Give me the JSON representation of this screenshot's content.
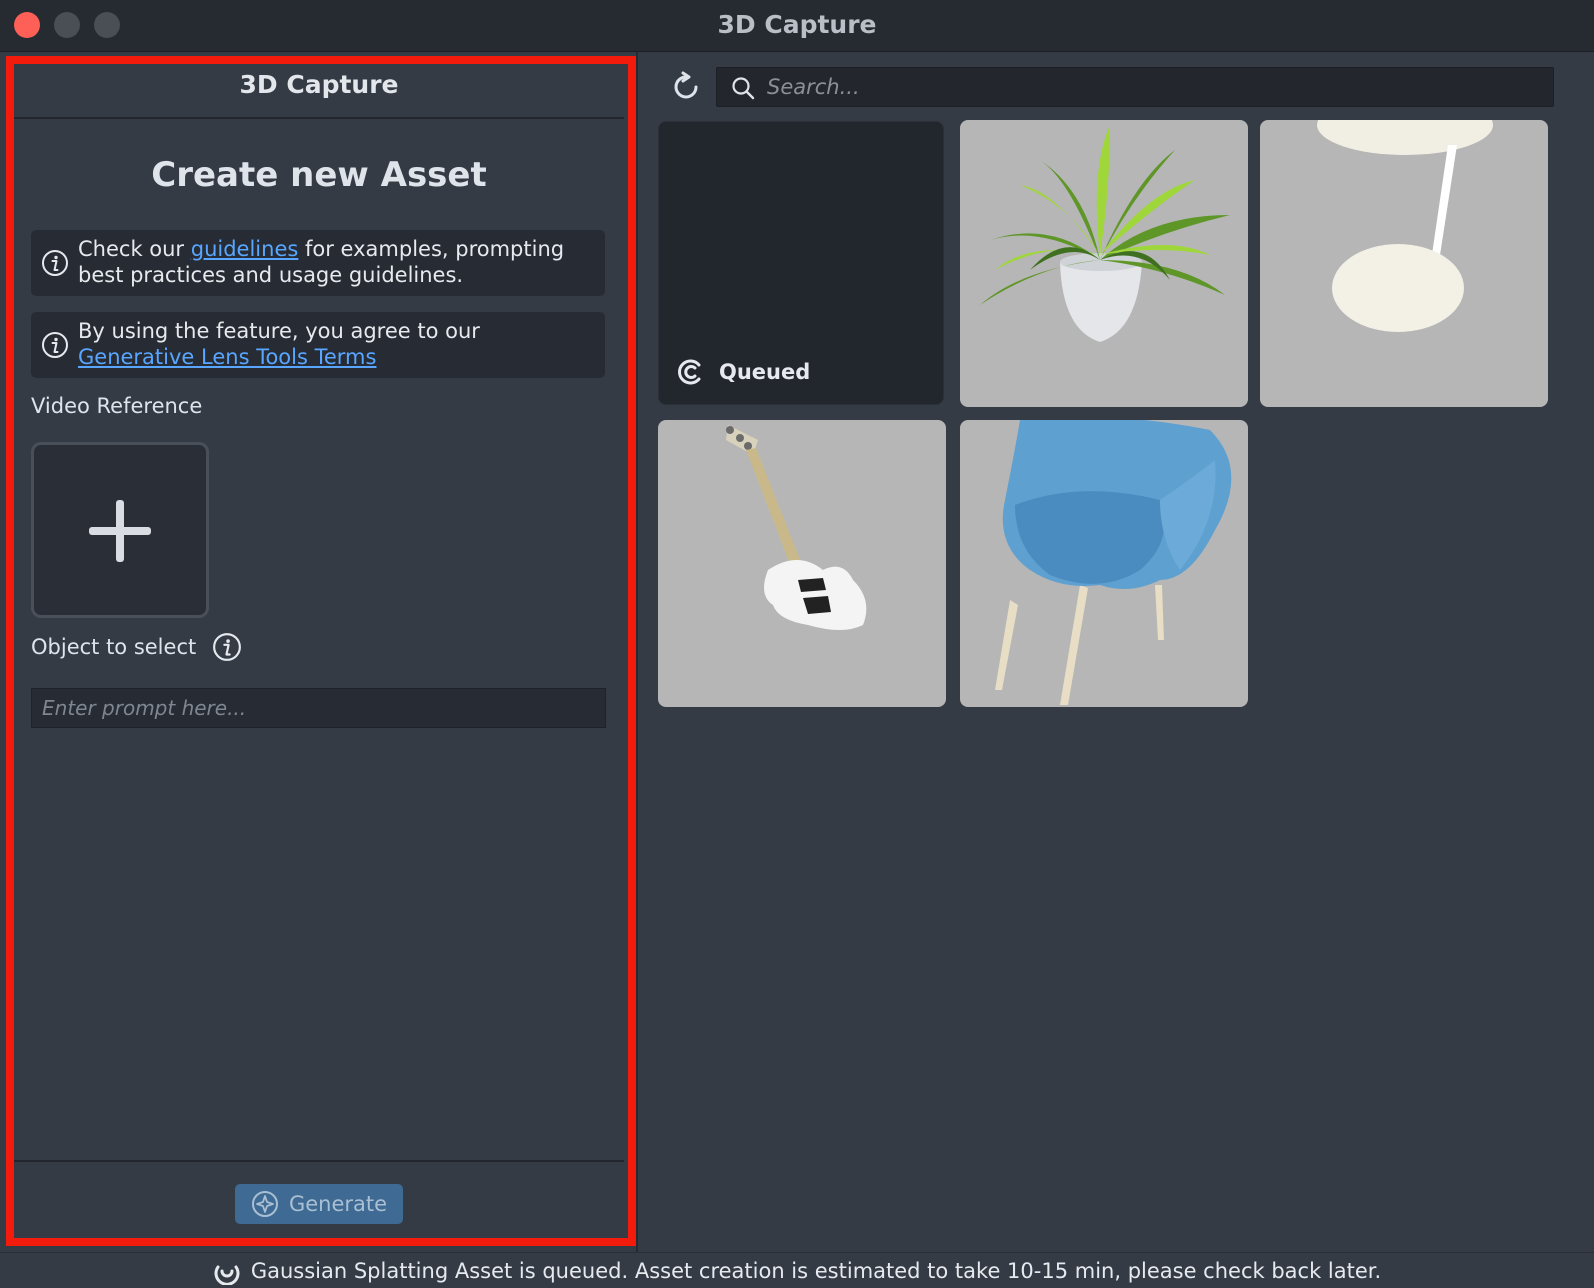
{
  "window": {
    "title": "3D Capture"
  },
  "left_panel": {
    "header": "3D Capture",
    "create_title": "Create new Asset",
    "info1": {
      "before": "Check our ",
      "link": "guidelines",
      "after": " for examples, prompting best practices and usage guidelines."
    },
    "info2": {
      "before": "By using the feature, you agree to our ",
      "link": "Generative Lens Tools Terms"
    },
    "video_label": "Video Reference",
    "object_label": "Object to select",
    "prompt_placeholder": "Enter prompt here...",
    "generate_label": "Generate"
  },
  "right_panel": {
    "search_placeholder": "Search...",
    "tiles": [
      {
        "name": "queued",
        "status": "Queued"
      },
      {
        "name": "plant"
      },
      {
        "name": "lamp"
      },
      {
        "name": "guitar"
      },
      {
        "name": "chair"
      }
    ]
  },
  "status_bar": {
    "message": "Gaussian Splatting Asset is queued. Asset creation is estimated to take 10-15 min, please check back later."
  },
  "colors": {
    "highlight": "#f21b0c",
    "link": "#58a6ff",
    "generate_bg": "#3f6a93",
    "close_dot": "#fe5f57"
  }
}
